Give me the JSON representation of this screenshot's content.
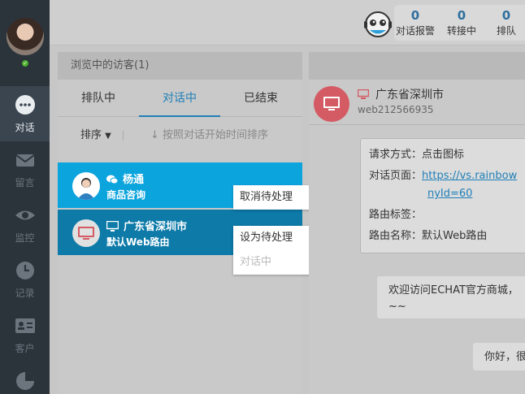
{
  "nav": {
    "items": [
      {
        "label": "对话",
        "icon": "chat-bubble-icon"
      },
      {
        "label": "留言",
        "icon": "envelope-icon"
      },
      {
        "label": "监控",
        "icon": "eye-icon"
      },
      {
        "label": "记录",
        "icon": "clock-icon"
      },
      {
        "label": "客户",
        "icon": "contact-card-icon"
      },
      {
        "label": "",
        "icon": "pie-chart-icon"
      }
    ]
  },
  "topbar": {
    "stats": [
      {
        "value": "0",
        "label": "对话报警"
      },
      {
        "value": "0",
        "label": "转接中"
      },
      {
        "value": "0",
        "label": "排队"
      }
    ]
  },
  "visitors": {
    "header": "浏览中的访客(1)",
    "tabs": [
      "排队中",
      "对话中",
      "已结束"
    ],
    "sort_label": "排序",
    "sort_hint": "按照对话开始时间排序",
    "items": [
      {
        "name": "杨通",
        "sub": "商品咨询"
      },
      {
        "name": "广东省深圳市",
        "sub": "默认Web路由"
      }
    ],
    "popup1": [
      "取消待处理"
    ],
    "popup2": [
      "设为待处理",
      "对话中"
    ]
  },
  "chat": {
    "title": "广东省深圳市",
    "visitor_id": "web212566935",
    "info": {
      "method_key": "请求方式：",
      "method_val": "点击图标",
      "page_key": "对话页面：",
      "page_val_1": "https://vs.rainbow",
      "page_val_2": "nyId=60",
      "tag_key": "路由标签：",
      "route_key": "路由名称：",
      "route_val": "默认Web路由"
    },
    "messages": [
      {
        "line1": "欢迎访问ECHAT官方商城，",
        "line2": "~~"
      },
      {
        "line1": "你好，很"
      }
    ]
  },
  "colors": {
    "accent": "#0ca4dd",
    "accent_dark": "#0d7aa8",
    "nav_bg": "#2b333b",
    "link": "#1f7fb8",
    "monitor_red": "#d45b63"
  }
}
